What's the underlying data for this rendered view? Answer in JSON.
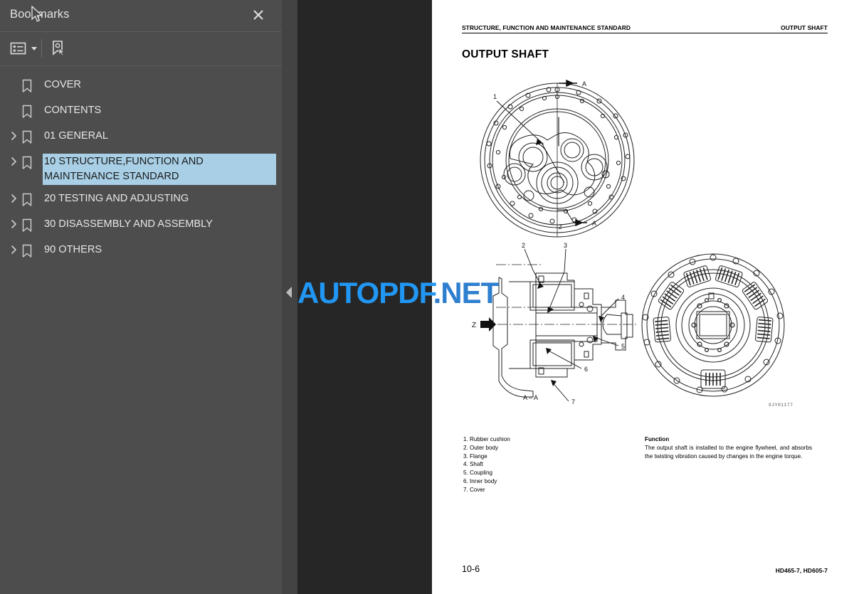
{
  "sidebar": {
    "title": "Bookmarks",
    "close_icon": "close-icon",
    "toolbar": {
      "options_icon": "list-options-icon",
      "options_caret": "chevron-down-icon",
      "new_bookmark_icon": "new-bookmark-icon"
    },
    "items": [
      {
        "label": "COVER",
        "expandable": false,
        "selected": false
      },
      {
        "label": "CONTENTS",
        "expandable": false,
        "selected": false
      },
      {
        "label": "01 GENERAL",
        "expandable": true,
        "selected": false
      },
      {
        "label": "10 STRUCTURE,FUNCTION AND\nMAINTENANCE STANDARD",
        "expandable": true,
        "selected": true
      },
      {
        "label": "20 TESTING AND ADJUSTING",
        "expandable": true,
        "selected": false
      },
      {
        "label": "30 DISASSEMBLY AND ASSEMBLY",
        "expandable": true,
        "selected": false
      },
      {
        "label": "90 OTHERS",
        "expandable": true,
        "selected": false
      }
    ]
  },
  "splitter": {
    "collapse_icon": "triangle-left-icon"
  },
  "document": {
    "running_head_left": "STRUCTURE, FUNCTION AND MAINTENANCE STANDARD",
    "running_head_right": "OUTPUT SHAFT",
    "title": "OUTPUT SHAFT",
    "drawing_code": "9JY01177",
    "figures": {
      "top_callouts": [
        "1",
        "A",
        "A",
        "Z"
      ],
      "section_label": "A – A",
      "section_callouts": [
        "2",
        "3",
        "4",
        "5",
        "6",
        "7"
      ],
      "view_direction": "Z"
    },
    "parts_list": [
      "1. Rubber cushion",
      "2. Outer body",
      "3. Flange",
      "4. Shaft",
      "5. Coupling",
      "6. Inner body",
      "7. Cover"
    ],
    "function_heading": "Function",
    "function_text": "The output shaft is installed to the engine flywheel, and absorbs the twisting vibration caused by changes in the engine torque.",
    "page_number": "10-6",
    "model": "HD465-7, HD605-7"
  },
  "watermark": {
    "text_main": "AUTOPDF",
    "text_suffix": ".NET",
    "color": "#2196f3"
  }
}
